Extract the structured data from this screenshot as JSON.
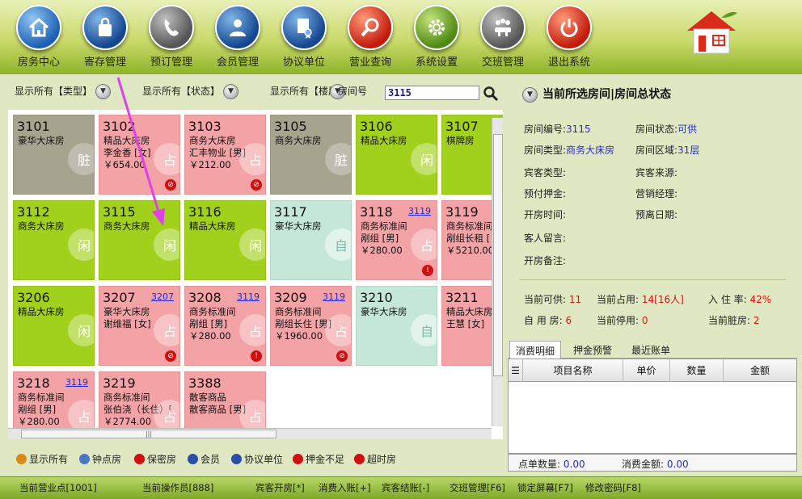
{
  "toolbar": {
    "items": [
      {
        "label": "房务中心",
        "icon": "house-icon"
      },
      {
        "label": "寄存管理",
        "icon": "bag-icon"
      },
      {
        "label": "预订管理",
        "icon": "phone-icon"
      },
      {
        "label": "会员管理",
        "icon": "user-icon"
      },
      {
        "label": "协议单位",
        "icon": "certificate-icon"
      },
      {
        "label": "营业查询",
        "icon": "magnifier-icon"
      },
      {
        "label": "系统设置",
        "icon": "gear-icon"
      },
      {
        "label": "交班管理",
        "icon": "meeting-icon"
      },
      {
        "label": "退出系统",
        "icon": "power-icon"
      }
    ]
  },
  "filters": {
    "type_label": "显示所有【类型】",
    "status_label": "显示所有【状态】",
    "floor_label": "显示所有【楼层】",
    "room_label": "房间号",
    "search_value": "3115"
  },
  "rooms": [
    {
      "no": "3101",
      "type": "豪华大床房",
      "guest": "",
      "price": "",
      "status": "gray",
      "badge": "脏",
      "link": "",
      "flag": ""
    },
    {
      "no": "3102",
      "type": "精品大床房",
      "guest": "李金香 [女]",
      "price": "￥654.00",
      "status": "pink",
      "badge": "占",
      "link": "",
      "flag": "⊘"
    },
    {
      "no": "3103",
      "type": "商务大床房",
      "guest": "汇丰物业 [男]",
      "price": "￥212.00",
      "status": "pink",
      "badge": "占",
      "link": "",
      "flag": "⊘"
    },
    {
      "no": "3105",
      "type": "商务大床房",
      "guest": "",
      "price": "",
      "status": "gray",
      "badge": "脏",
      "link": "",
      "flag": ""
    },
    {
      "no": "3106",
      "type": "精品大床房",
      "guest": "",
      "price": "",
      "status": "green",
      "badge": "闲",
      "link": "",
      "flag": ""
    },
    {
      "no": "3107",
      "type": "棋牌房",
      "guest": "",
      "price": "",
      "status": "green",
      "badge": "闲",
      "link": "",
      "flag": ""
    },
    {
      "no": "3112",
      "type": "商务大床房",
      "guest": "",
      "price": "",
      "status": "green",
      "badge": "闲",
      "link": "",
      "flag": ""
    },
    {
      "no": "3115",
      "type": "商务大床房",
      "guest": "",
      "price": "",
      "status": "green",
      "badge": "闲",
      "link": "",
      "flag": ""
    },
    {
      "no": "3116",
      "type": "精品大床房",
      "guest": "",
      "price": "",
      "status": "green",
      "badge": "闲",
      "link": "",
      "flag": ""
    },
    {
      "no": "3117",
      "type": "豪华大床房",
      "guest": "",
      "price": "",
      "status": "teal",
      "badge": "自",
      "link": "",
      "flag": ""
    },
    {
      "no": "3118",
      "type": "商务标准间",
      "guest": "剐组 [男]",
      "price": "￥280.00",
      "status": "pink",
      "badge": "占",
      "link": "3119",
      "flag": "!"
    },
    {
      "no": "3119",
      "type": "商务标准间",
      "guest": "剐组长租 [",
      "price": "￥5210.00",
      "status": "pink",
      "badge": "占",
      "link": "",
      "flag": ""
    },
    {
      "no": "3206",
      "type": "精品大床房",
      "guest": "",
      "price": "",
      "status": "green",
      "badge": "闲",
      "link": "",
      "flag": ""
    },
    {
      "no": "3207",
      "type": "豪华大床房",
      "guest": "谢维福 [女]",
      "price": "",
      "status": "pink",
      "badge": "占",
      "link": "3207",
      "flag": "⊘"
    },
    {
      "no": "3208",
      "type": "商务标准间",
      "guest": "剐组 [男]",
      "price": "￥280.00",
      "status": "pink",
      "badge": "占",
      "link": "3119",
      "flag": "!"
    },
    {
      "no": "3209",
      "type": "商务标准间",
      "guest": "剐组长住 [男]",
      "price": "￥1960.00",
      "status": "pink",
      "badge": "占",
      "link": "3119",
      "flag": "⊘"
    },
    {
      "no": "3210",
      "type": "豪华大床房",
      "guest": "",
      "price": "",
      "status": "teal",
      "badge": "自",
      "link": "",
      "flag": ""
    },
    {
      "no": "3211",
      "type": "精品大床房",
      "guest": "王慧 [女]",
      "price": "",
      "status": "pink",
      "badge": "占",
      "link": "",
      "flag": ""
    },
    {
      "no": "3218",
      "type": "商务标准间",
      "guest": "剐组 [男]",
      "price": "￥280.00",
      "status": "pink",
      "badge": "占",
      "link": "3119",
      "flag": ""
    },
    {
      "no": "3219",
      "type": "商务标准间",
      "guest": "张伯浇（长住）[",
      "price": "￥2774.00",
      "status": "pink",
      "badge": "占",
      "link": "",
      "flag": ""
    },
    {
      "no": "3388",
      "type": "散客商品",
      "guest": "散客商品 [男]",
      "price": "",
      "status": "pink",
      "badge": "占",
      "link": "",
      "flag": ""
    }
  ],
  "legend": [
    {
      "label": "显示所有",
      "color": "#d98a1c"
    },
    {
      "label": "钟点房",
      "color": "#4a76c8"
    },
    {
      "label": "保密房",
      "color": "#d01010"
    },
    {
      "label": "会员",
      "color": "#2a4fa8"
    },
    {
      "label": "协议单位",
      "color": "#2a4fa8"
    },
    {
      "label": "押金不足",
      "color": "#d01010"
    },
    {
      "label": "超时房",
      "color": "#d01010"
    }
  ],
  "right": {
    "title": "当前所选房间|房间总状态",
    "fields": {
      "room_no_label": "房间编号:",
      "room_no": "3115",
      "room_status_label": "房间状态:",
      "room_status": "可供",
      "room_type_label": "房间类型:",
      "room_type": "商务大床房",
      "room_area_label": "房间区域:",
      "room_area": "31层",
      "guest_type_label": "宾客类型:",
      "guest_source_label": "宾客来源:",
      "deposit_label": "预付押金:",
      "manager_label": "营销经理:",
      "open_time_label": "开房时间:",
      "leave_date_label": "预离日期:",
      "message_label": "客人留言:",
      "remark_label": "开房备注:"
    },
    "stats": {
      "available_label": "当前可供:",
      "available": "11",
      "occupied_label": "当前占用:",
      "occupied": "14[16人]",
      "rate_label": "入 住 率:",
      "rate": "42%",
      "self_label": "自 用 房:",
      "self": "6",
      "stopped_label": "当前停用:",
      "stopped": "0",
      "dirty_label": "当前脏房:",
      "dirty": "2"
    },
    "tabs": [
      "消费明细",
      "押金预警",
      "最近账单"
    ],
    "columns": [
      "项目名称",
      "单价",
      "数量",
      "金额"
    ],
    "summary": {
      "count_label": "点单数量:",
      "count": "0.00",
      "amount_label": "消费金额:",
      "amount": "0.00"
    }
  },
  "statusbar": [
    "当前营业点[1001]",
    "当前操作员[888]",
    "宾客开房[*]",
    "消费入账[+]",
    "宾客结账[-]",
    "交班管理[F6]",
    "锁定屏幕[F7]",
    "修改密码[F8]"
  ]
}
